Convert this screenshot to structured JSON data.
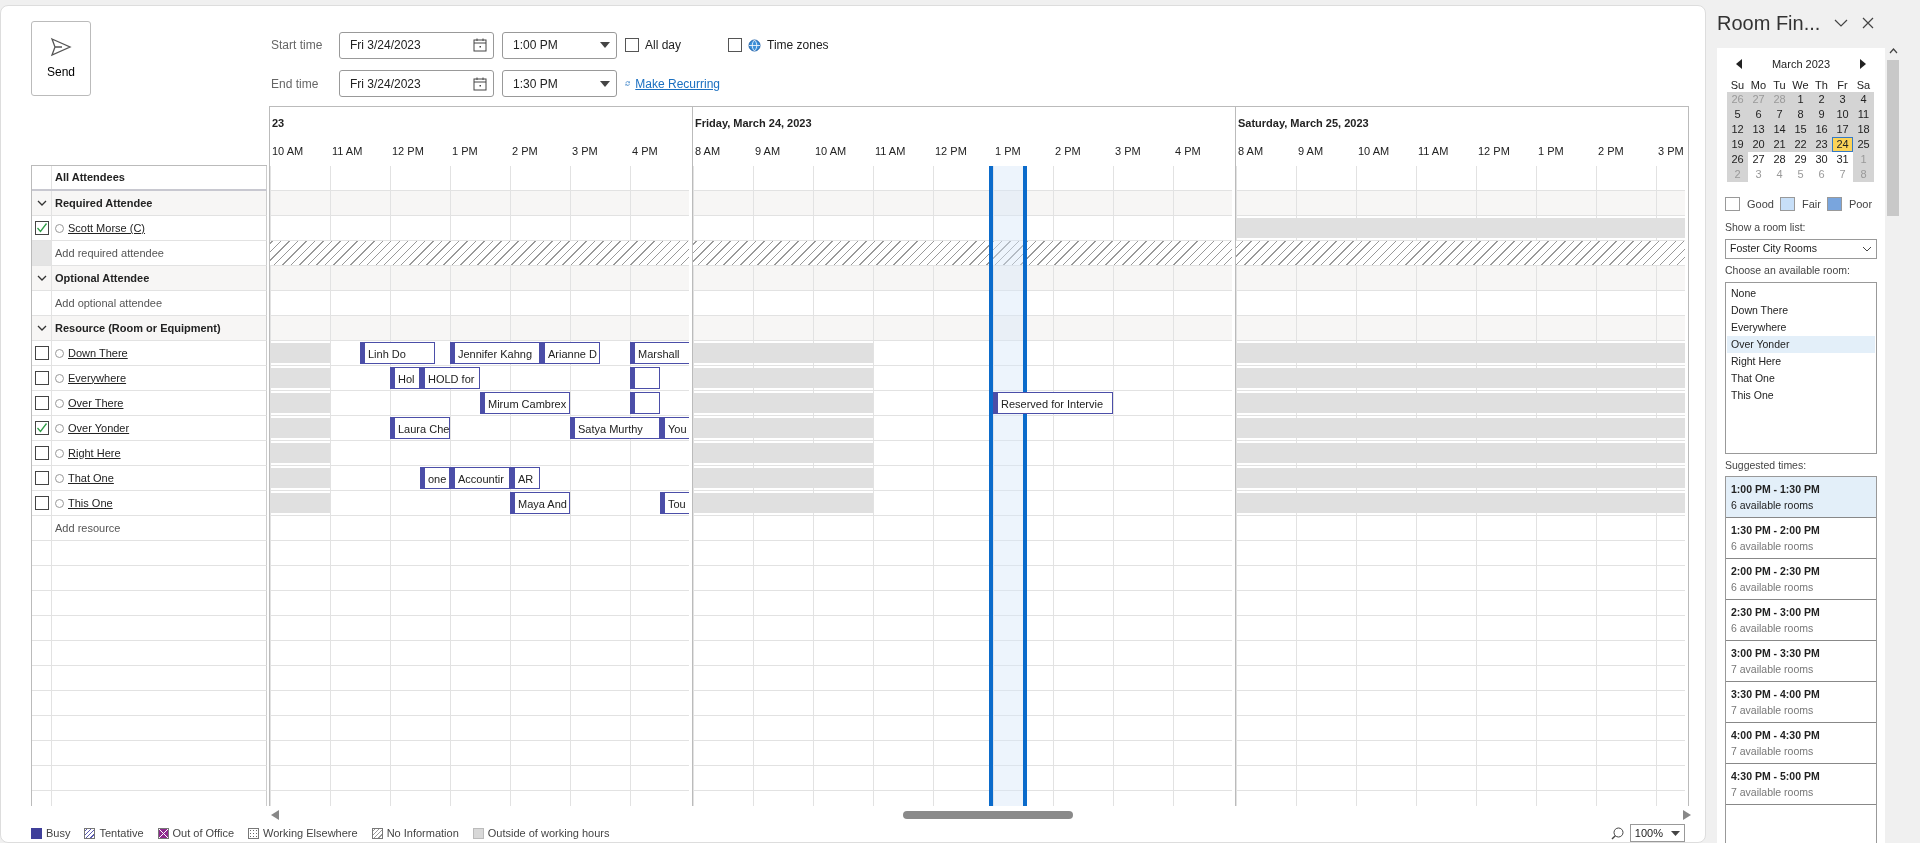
{
  "toolbar": {
    "send": "Send"
  },
  "meeting": {
    "start_label": "Start time",
    "start_date": "Fri 3/24/2023",
    "start_time": "1:00 PM",
    "end_label": "End time",
    "end_date": "Fri 3/24/2023",
    "end_time": "1:30 PM",
    "all_day": {
      "label": "All day",
      "checked": false
    },
    "time_zones": {
      "label": "Time zones",
      "checked": false
    },
    "recurrence": "Make Recurring"
  },
  "scheduler": {
    "attendees_header": "All Attendees",
    "days": [
      {
        "label": "23",
        "hours": [
          "10 AM",
          "11 AM",
          "12 PM",
          "1 PM",
          "2 PM",
          "3 PM",
          "4 PM"
        ]
      },
      {
        "label": "Friday, March 24, 2023",
        "hours": [
          "8 AM",
          "9 AM",
          "10 AM",
          "11 AM",
          "12 PM",
          "1 PM",
          "2 PM",
          "3 PM",
          "4 PM"
        ]
      },
      {
        "label": "Saturday, March 25, 2023",
        "hours": [
          "8 AM",
          "9 AM",
          "10 AM",
          "11 AM",
          "12 PM",
          "1 PM",
          "2 PM",
          "3 PM"
        ]
      }
    ],
    "rows": [
      {
        "kind": "group",
        "label": "Required Attendee",
        "expanded": true
      },
      {
        "kind": "attendee",
        "name": "Scott Morse (C)",
        "checked": true
      },
      {
        "kind": "add",
        "label": "Add required attendee",
        "no_information": true
      },
      {
        "kind": "group",
        "label": "Optional Attendee",
        "expanded": true
      },
      {
        "kind": "add",
        "label": "Add optional attendee",
        "no_information": false
      },
      {
        "kind": "group",
        "label": "Resource (Room or Equipment)",
        "expanded": true
      },
      {
        "kind": "attendee",
        "name": "Down There",
        "checked": false,
        "meetings": [
          {
            "kind": "busy",
            "title": "Linh Do"
          },
          {
            "kind": "busy",
            "title": "Jennifer Kahng"
          },
          {
            "kind": "busy",
            "title": "Arianne D"
          },
          {
            "kind": "busy",
            "title": "Marshall"
          }
        ]
      },
      {
        "kind": "attendee",
        "name": "Everywhere",
        "checked": false,
        "meetings": [
          {
            "kind": "busy",
            "title": "Hol"
          },
          {
            "kind": "busy",
            "title": "HOLD for"
          },
          {
            "kind": "busy"
          }
        ]
      },
      {
        "kind": "attendee",
        "name": "Over There",
        "checked": false,
        "meetings": [
          {
            "kind": "busy",
            "title": "Mirum Cambrex"
          },
          {
            "kind": "busy"
          },
          {
            "kind": "busy",
            "title": "Reserved for Intervie"
          }
        ]
      },
      {
        "kind": "attendee",
        "name": "Over Yonder",
        "checked": true,
        "meetings": [
          {
            "kind": "busy",
            "title": "Laura Che"
          },
          {
            "kind": "busy",
            "title": "Satya Murthy"
          },
          {
            "kind": "busy",
            "title": "You"
          }
        ]
      },
      {
        "kind": "attendee",
        "name": "Right Here",
        "checked": false
      },
      {
        "kind": "attendee",
        "name": "That One",
        "checked": false,
        "meetings": [
          {
            "kind": "busy",
            "title": "one"
          },
          {
            "kind": "busy",
            "title": "Accountir"
          },
          {
            "kind": "busy",
            "title": "AR"
          }
        ]
      },
      {
        "kind": "attendee",
        "name": "This One",
        "checked": false,
        "meetings": [
          {
            "kind": "busy",
            "title": "Maya And"
          },
          {
            "kind": "busy",
            "title": "Tou"
          }
        ]
      },
      {
        "kind": "add",
        "label": "Add resource",
        "no_information": false
      }
    ]
  },
  "legend": [
    {
      "label": "Busy",
      "kind": "busy"
    },
    {
      "label": "Tentative",
      "kind": "tentative"
    },
    {
      "label": "Out of Office",
      "kind": "oof"
    },
    {
      "label": "Working Elsewhere",
      "kind": "elsewhere"
    },
    {
      "label": "No Information",
      "kind": "noinfo"
    },
    {
      "label": "Outside of working hours",
      "kind": "outside"
    }
  ],
  "zoom": "100%",
  "room_finder": {
    "title": "Room Fin...",
    "calendar": {
      "month": "March 2023",
      "weekdays": [
        "Su",
        "Mo",
        "Tu",
        "We",
        "Th",
        "Fr",
        "Sa"
      ],
      "weeks": [
        [
          {
            "label": "26",
            "other_month": true,
            "shaded": true,
            "selected": false
          },
          {
            "label": "27",
            "other_month": true,
            "shaded": true,
            "selected": false
          },
          {
            "label": "28",
            "other_month": true,
            "shaded": true,
            "selected": false
          },
          {
            "label": "1",
            "other_month": false,
            "shaded": true,
            "selected": false
          },
          {
            "label": "2",
            "other_month": false,
            "shaded": true,
            "selected": false
          },
          {
            "label": "3",
            "other_month": false,
            "shaded": true,
            "selected": false
          },
          {
            "label": "4",
            "other_month": false,
            "shaded": true,
            "selected": false
          }
        ],
        [
          {
            "label": "5",
            "other_month": false,
            "shaded": true,
            "selected": false
          },
          {
            "label": "6",
            "other_month": false,
            "shaded": true,
            "selected": false
          },
          {
            "label": "7",
            "other_month": false,
            "shaded": true,
            "selected": false
          },
          {
            "label": "8",
            "other_month": false,
            "shaded": true,
            "selected": false
          },
          {
            "label": "9",
            "other_month": false,
            "shaded": true,
            "selected": false
          },
          {
            "label": "10",
            "other_month": false,
            "shaded": true,
            "selected": false
          },
          {
            "label": "11",
            "other_month": false,
            "shaded": true,
            "selected": false
          }
        ],
        [
          {
            "label": "12",
            "other_month": false,
            "shaded": true,
            "selected": false
          },
          {
            "label": "13",
            "other_month": false,
            "shaded": true,
            "selected": false
          },
          {
            "label": "14",
            "other_month": false,
            "shaded": true,
            "selected": false
          },
          {
            "label": "15",
            "other_month": false,
            "shaded": true,
            "selected": false
          },
          {
            "label": "16",
            "other_month": false,
            "shaded": true,
            "selected": false
          },
          {
            "label": "17",
            "other_month": false,
            "shaded": true,
            "selected": false
          },
          {
            "label": "18",
            "other_month": false,
            "shaded": true,
            "selected": false
          }
        ],
        [
          {
            "label": "19",
            "other_month": false,
            "shaded": true,
            "selected": false
          },
          {
            "label": "20",
            "other_month": false,
            "shaded": true,
            "selected": false
          },
          {
            "label": "21",
            "other_month": false,
            "shaded": true,
            "selected": false
          },
          {
            "label": "22",
            "other_month": false,
            "shaded": true,
            "selected": false
          },
          {
            "label": "23",
            "other_month": false,
            "shaded": true,
            "selected": false
          },
          {
            "label": "24",
            "other_month": false,
            "shaded": true,
            "selected": true
          },
          {
            "label": "25",
            "other_month": false,
            "shaded": true,
            "selected": false
          }
        ],
        [
          {
            "label": "26",
            "other_month": false,
            "shaded": true,
            "selected": false
          },
          {
            "label": "27",
            "other_month": false,
            "shaded": false,
            "selected": false
          },
          {
            "label": "28",
            "other_month": false,
            "shaded": false,
            "selected": false
          },
          {
            "label": "29",
            "other_month": false,
            "shaded": false,
            "selected": false
          },
          {
            "label": "30",
            "other_month": false,
            "shaded": false,
            "selected": false
          },
          {
            "label": "31",
            "other_month": false,
            "shaded": false,
            "selected": false
          },
          {
            "label": "1",
            "other_month": true,
            "shaded": true,
            "selected": false
          }
        ],
        [
          {
            "label": "2",
            "other_month": true,
            "shaded": true,
            "selected": false
          },
          {
            "label": "3",
            "other_month": true,
            "shaded": false,
            "selected": false
          },
          {
            "label": "4",
            "other_month": true,
            "shaded": false,
            "selected": false
          },
          {
            "label": "5",
            "other_month": true,
            "shaded": false,
            "selected": false
          },
          {
            "label": "6",
            "other_month": true,
            "shaded": false,
            "selected": false
          },
          {
            "label": "7",
            "other_month": true,
            "shaded": false,
            "selected": false
          },
          {
            "label": "8",
            "other_month": true,
            "shaded": true,
            "selected": false
          }
        ]
      ]
    },
    "availability_legend": [
      {
        "label": "Good",
        "color": "#ffffff"
      },
      {
        "label": "Fair",
        "color": "#c7dff8"
      },
      {
        "label": "Poor",
        "color": "#79a5dd"
      }
    ],
    "room_list_label": "Show a room list:",
    "room_list": "Foster City Rooms",
    "rooms_label": "Choose an available room:",
    "rooms": [
      {
        "name": "None",
        "selected": false
      },
      {
        "name": "Down There",
        "selected": false
      },
      {
        "name": "Everywhere",
        "selected": false
      },
      {
        "name": "Over Yonder",
        "selected": true
      },
      {
        "name": "Right Here",
        "selected": false
      },
      {
        "name": "That One",
        "selected": false
      },
      {
        "name": "This One",
        "selected": false
      }
    ],
    "suggested_label": "Suggested times:",
    "suggestions": [
      {
        "time": "1:00 PM - 1:30 PM",
        "rooms": "6 available rooms",
        "selected": true
      },
      {
        "time": "1:30 PM - 2:00 PM",
        "rooms": "6 available rooms",
        "selected": false
      },
      {
        "time": "2:00 PM - 2:30 PM",
        "rooms": "6 available rooms",
        "selected": false
      },
      {
        "time": "2:30 PM - 3:00 PM",
        "rooms": "6 available rooms",
        "selected": false
      },
      {
        "time": "3:00 PM - 3:30 PM",
        "rooms": "7 available rooms",
        "selected": false
      },
      {
        "time": "3:30 PM - 4:00 PM",
        "rooms": "7 available rooms",
        "selected": false
      },
      {
        "time": "4:00 PM - 4:30 PM",
        "rooms": "7 available rooms",
        "selected": false
      },
      {
        "time": "4:30 PM - 5:00 PM",
        "rooms": "7 available rooms",
        "selected": false
      }
    ]
  }
}
